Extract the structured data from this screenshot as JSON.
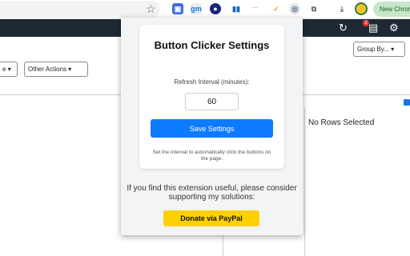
{
  "browser": {
    "new_chrome_label": "New Chrom",
    "icons": {
      "star": "bookmark-star-icon",
      "extensions": [
        "ext-screenshot-icon",
        "ext-grammarly-icon",
        "ext-gm-icon",
        "ext-analytics-icon",
        "ext-tool-icon",
        "ext-vee-icon",
        "ext-button-clicker-icon",
        "ext-puzzle-icon"
      ],
      "download": "download-icon",
      "avatar": "profile-avatar"
    },
    "ext_glyphs": {
      "e1": "▣",
      "e2": "gm",
      "e3": "●",
      "e4": "▮▮",
      "e5": "···",
      "e6": "✓",
      "e7": "◎",
      "e8": "⧉",
      "e9": "⤓"
    }
  },
  "app": {
    "header_icons": {
      "refresh": "↻",
      "print": "▤",
      "print_badge": "2",
      "settings": "⚙"
    },
    "left_select_label": "e",
    "other_actions_label": "Other Actions",
    "group_by_label": "Group By...",
    "no_rows_label": "No Rows Selected"
  },
  "popup": {
    "title": "Button Clicker Settings",
    "interval_label": "Refresh Interval (minutes):",
    "interval_value": "60",
    "save_label": "Save Settings",
    "help_text": "Set the interval to automatically click the buttons on the page.",
    "support_text": "If you find this extension useful, please consider supporting my solutions:",
    "donate_label": "Donate via PayPal"
  },
  "colors": {
    "accent": "#0d7bff",
    "donate": "#ffd000",
    "header_dark": "#1f2933"
  }
}
